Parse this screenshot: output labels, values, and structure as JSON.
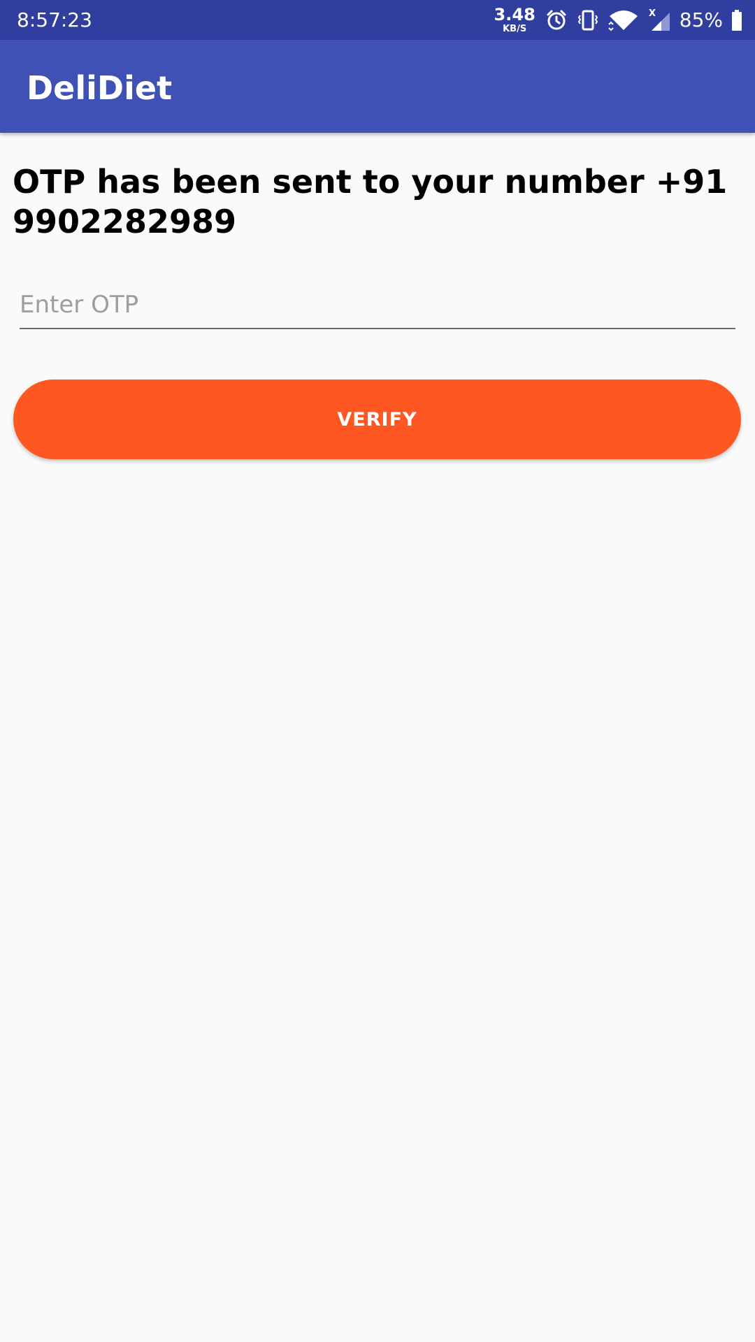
{
  "status_bar": {
    "time": "8:57:23",
    "net_speed_value": "3.48",
    "net_speed_unit": "KB/S",
    "battery_percent": "85%",
    "icons": [
      "alarm-icon",
      "vibrate-icon",
      "wifi-icon",
      "cell-signal-icon",
      "battery-icon"
    ],
    "background_color": "#303f9f"
  },
  "app_bar": {
    "title": "DeliDiet",
    "background_color": "#3f51b5"
  },
  "main": {
    "otp_message": "OTP has been sent to your number +91 9902282989",
    "otp_input": {
      "value": "",
      "placeholder": "Enter OTP"
    },
    "verify_button": {
      "label": "VERIFY",
      "color": "#ff5722"
    }
  }
}
